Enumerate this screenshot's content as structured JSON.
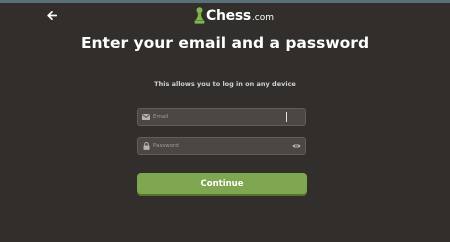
{
  "brand": {
    "name": "Chess",
    "suffix": ".com"
  },
  "header": {
    "back_icon": "arrow-left-icon"
  },
  "title": "Enter your email and a password",
  "subtitle": "This allows you to log in on any device",
  "form": {
    "email": {
      "placeholder": "Email",
      "value": "",
      "icon": "envelope-icon"
    },
    "password": {
      "placeholder": "Password",
      "value": "",
      "icon": "lock-icon",
      "toggle_icon": "eye-icon"
    },
    "continue_label": "Continue"
  },
  "colors": {
    "background": "#312e2b",
    "button": "#7fa650",
    "input_bg": "#4a4744",
    "logo_green": "#81b64c"
  }
}
